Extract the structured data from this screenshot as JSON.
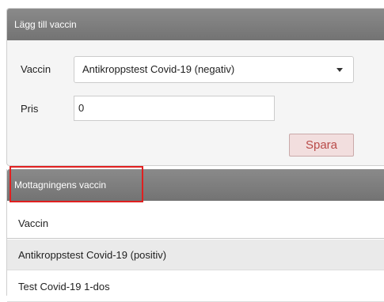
{
  "add_panel": {
    "title": "Lägg till vaccin",
    "vaccine_label": "Vaccin",
    "vaccine_selected": "Antikroppstest Covid-19 (negativ)",
    "price_label": "Pris",
    "price_value": "0",
    "save_label": "Spara"
  },
  "list_panel": {
    "title": "Mottagningens vaccin",
    "column_header": "Vaccin",
    "rows": [
      "Antikroppstest Covid-19 (positiv)",
      "Test Covid-19 1-dos"
    ]
  },
  "colors": {
    "panel_header": "#7d7d7d",
    "save_button_bg": "#f2dede",
    "save_button_text": "#b94a48",
    "highlight_border": "#e02020"
  }
}
